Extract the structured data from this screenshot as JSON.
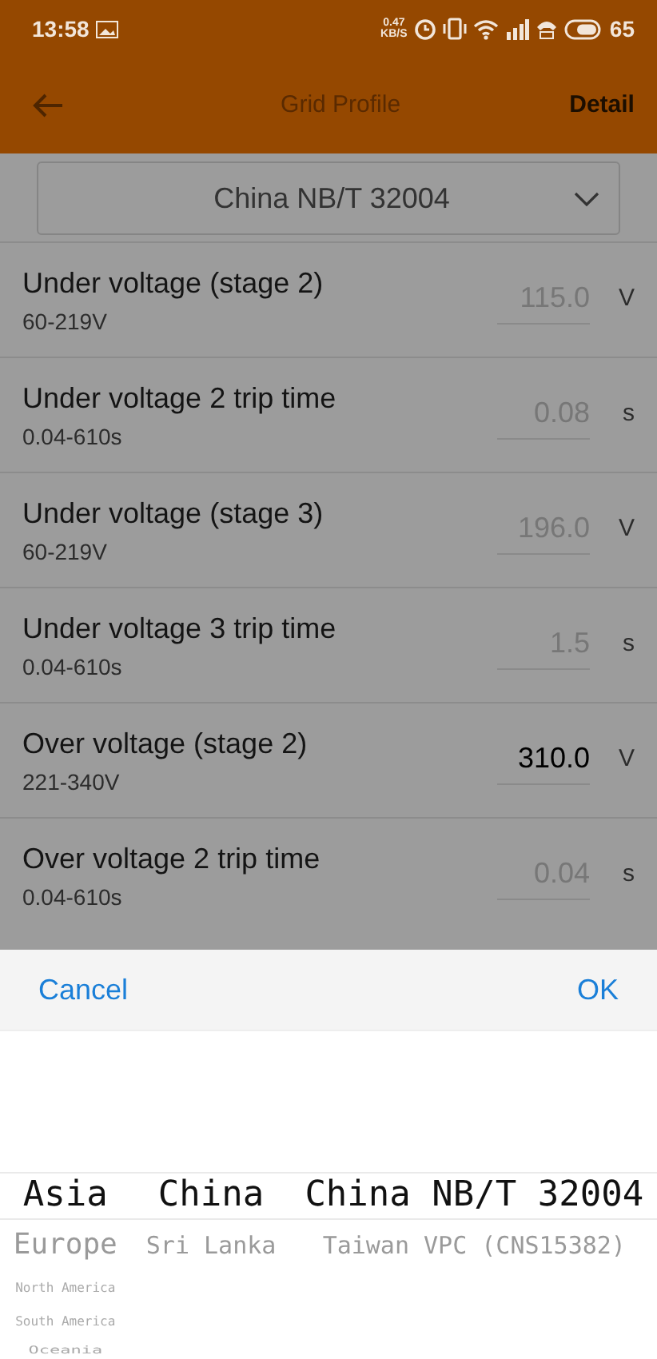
{
  "status_bar": {
    "time": "13:58",
    "net_speed": "0.47 KB/S",
    "battery": "65"
  },
  "app_bar": {
    "title": "Grid Profile",
    "action": "Detail"
  },
  "profile_select": {
    "value": "China NB/T 32004"
  },
  "settings": [
    {
      "label": "Under voltage (stage 2)",
      "range": "60-219V",
      "value": "115.0",
      "unit": "V",
      "editable": false
    },
    {
      "label": "Under voltage 2 trip time",
      "range": "0.04-610s",
      "value": "0.08",
      "unit": "s",
      "editable": false
    },
    {
      "label": "Under voltage (stage 3)",
      "range": "60-219V",
      "value": "196.0",
      "unit": "V",
      "editable": false
    },
    {
      "label": "Under voltage 3 trip time",
      "range": "0.04-610s",
      "value": "1.5",
      "unit": "s",
      "editable": false
    },
    {
      "label": "Over voltage (stage 2)",
      "range": "221-340V",
      "value": "310.0",
      "unit": "V",
      "editable": true
    },
    {
      "label": "Over voltage 2 trip time",
      "range": "0.04-610s",
      "value": "0.04",
      "unit": "s",
      "editable": false
    }
  ],
  "picker": {
    "cancel": "Cancel",
    "ok": "OK",
    "columns": [
      [
        {
          "label": "Asia",
          "selected": true
        },
        {
          "label": "Europe",
          "selected": false
        },
        {
          "label": "North America",
          "selected": false
        },
        {
          "label": "South America",
          "selected": false
        },
        {
          "label": "Oceania",
          "selected": false
        }
      ],
      [
        {
          "label": "China",
          "selected": true
        },
        {
          "label": "Sri Lanka",
          "selected": false
        }
      ],
      [
        {
          "label": "China NB/T 32004",
          "selected": true
        },
        {
          "label": "Taiwan VPC (CNS15382)",
          "selected": false
        }
      ]
    ]
  }
}
